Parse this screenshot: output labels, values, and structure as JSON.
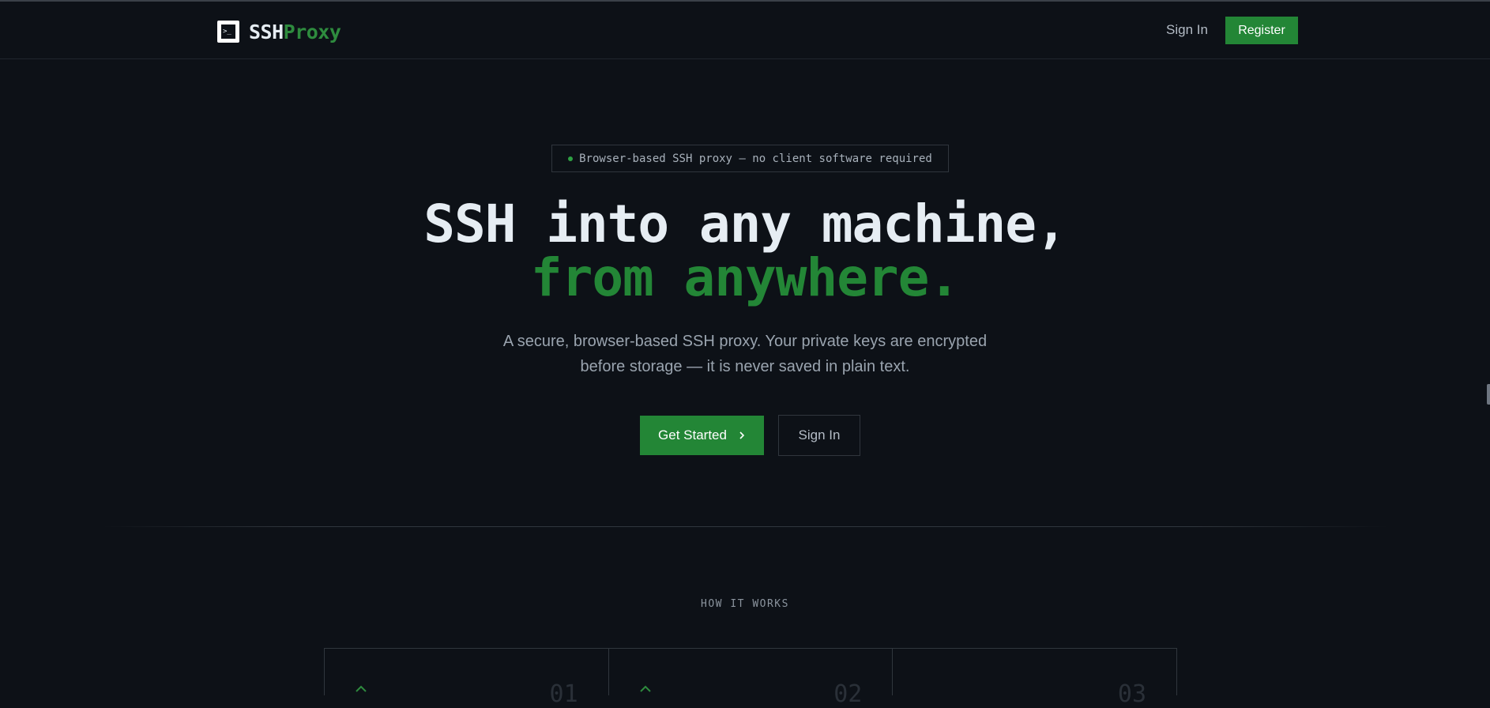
{
  "nav": {
    "brand_ssh": "SSH",
    "brand_proxy": "Proxy",
    "brand_icon_glyph": ">_",
    "signin_label": "Sign In",
    "register_label": "Register"
  },
  "hero": {
    "badge_text": "Browser-based SSH proxy — no client software required",
    "title_line1": "SSH into any machine,",
    "title_line2": "from anywhere.",
    "subtitle_line1": "A secure, browser-based SSH proxy. Your private keys are encrypted",
    "subtitle_line2": "before storage — it is never saved in plain text.",
    "cta_primary": "Get Started",
    "cta_primary_icon": "chevron-right-icon",
    "cta_secondary": "Sign In"
  },
  "how_it_works": {
    "label": "HOW IT WORKS",
    "steps": [
      {
        "number": "01"
      },
      {
        "number": "02"
      },
      {
        "number": "03"
      }
    ]
  },
  "colors": {
    "background": "#0d1117",
    "accent": "#238636",
    "border": "#30363d",
    "text": "#e6edf3",
    "muted": "#9aa4af"
  }
}
